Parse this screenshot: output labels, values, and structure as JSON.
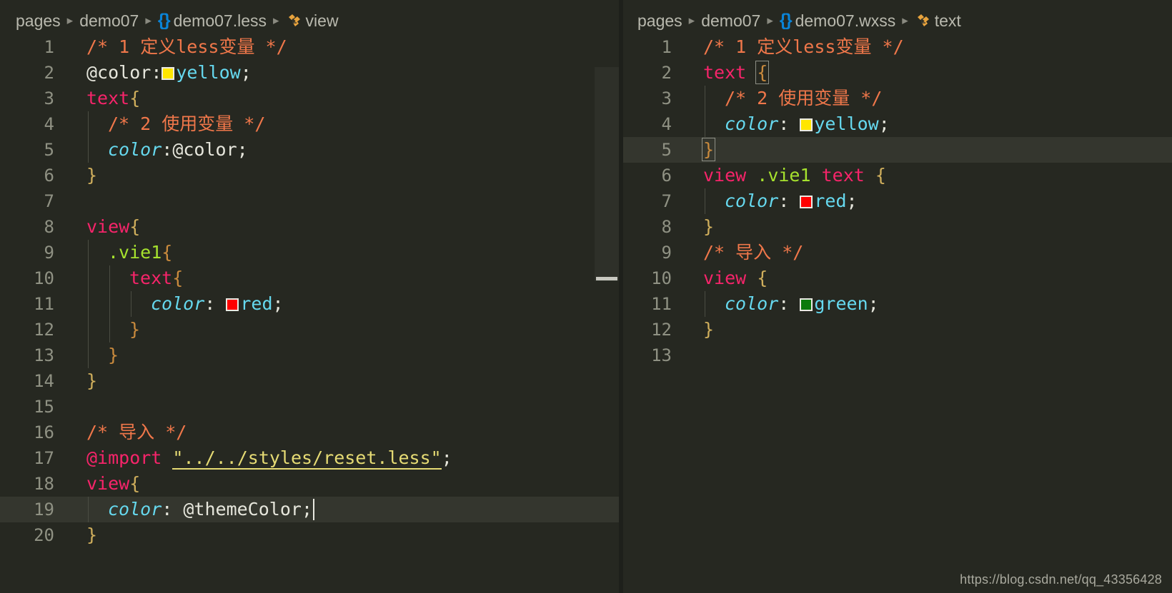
{
  "window": {
    "theme_bg": "#262821",
    "accent_blue": "#0a84d8",
    "current_line_bg": "#34362e"
  },
  "tabstrip": {
    "left_tab_label": "",
    "right_tab_label": ""
  },
  "left_pane": {
    "breadcrumb": {
      "items": [
        "pages",
        "demo07",
        "demo07.less",
        "view"
      ],
      "separator": "▸",
      "file_icon": "{}",
      "symbol_icon": "symbol-ruler-icon"
    },
    "lines": [
      {
        "n": "1",
        "indent": 0,
        "tokens": [
          {
            "t": "comment",
            "s": "/* 1 定义less变量 */"
          }
        ]
      },
      {
        "n": "2",
        "indent": 0,
        "tokens": [
          {
            "t": "var",
            "s": "@color"
          },
          {
            "t": "punc",
            "s": ":"
          },
          {
            "t": "swatch",
            "s": "yellow"
          },
          {
            "t": "val",
            "s": "yellow"
          },
          {
            "t": "semi",
            "s": ";"
          }
        ]
      },
      {
        "n": "3",
        "indent": 0,
        "tokens": [
          {
            "t": "tag",
            "s": "text"
          },
          {
            "t": "brace",
            "s": "{"
          }
        ]
      },
      {
        "n": "4",
        "indent": 1,
        "tokens": [
          {
            "t": "comment",
            "s": "/* 2 使用变量 */"
          }
        ]
      },
      {
        "n": "5",
        "indent": 1,
        "tokens": [
          {
            "t": "prop",
            "s": "color"
          },
          {
            "t": "punc",
            "s": ":"
          },
          {
            "t": "var",
            "s": "@color"
          },
          {
            "t": "semi",
            "s": ";"
          }
        ]
      },
      {
        "n": "6",
        "indent": 0,
        "tokens": [
          {
            "t": "brace",
            "s": "}"
          }
        ]
      },
      {
        "n": "7",
        "indent": 0,
        "tokens": []
      },
      {
        "n": "8",
        "indent": 0,
        "tokens": [
          {
            "t": "tag",
            "s": "view"
          },
          {
            "t": "brace",
            "s": "{"
          }
        ]
      },
      {
        "n": "9",
        "indent": 1,
        "tokens": [
          {
            "t": "class",
            "s": ".vie1"
          },
          {
            "t": "brace2",
            "s": "{"
          }
        ]
      },
      {
        "n": "10",
        "indent": 2,
        "tokens": [
          {
            "t": "tag",
            "s": "text"
          },
          {
            "t": "brace2",
            "s": "{"
          }
        ]
      },
      {
        "n": "11",
        "indent": 3,
        "tokens": [
          {
            "t": "prop",
            "s": "color"
          },
          {
            "t": "punc",
            "s": ": "
          },
          {
            "t": "swatch",
            "s": "red"
          },
          {
            "t": "val",
            "s": "red"
          },
          {
            "t": "semi",
            "s": ";"
          }
        ]
      },
      {
        "n": "12",
        "indent": 2,
        "tokens": [
          {
            "t": "brace2",
            "s": "}"
          }
        ]
      },
      {
        "n": "13",
        "indent": 1,
        "tokens": [
          {
            "t": "brace2",
            "s": "}"
          }
        ]
      },
      {
        "n": "14",
        "indent": 0,
        "tokens": [
          {
            "t": "brace",
            "s": "}"
          }
        ]
      },
      {
        "n": "15",
        "indent": 0,
        "tokens": []
      },
      {
        "n": "16",
        "indent": 0,
        "tokens": [
          {
            "t": "comment",
            "s": "/* 导入 */"
          }
        ]
      },
      {
        "n": "17",
        "indent": 0,
        "tokens": [
          {
            "t": "at",
            "s": "@import"
          },
          {
            "t": "plain",
            "s": " "
          },
          {
            "t": "str",
            "s": "\"../../styles/reset.less\""
          },
          {
            "t": "semi",
            "s": ";"
          }
        ]
      },
      {
        "n": "18",
        "indent": 0,
        "tokens": [
          {
            "t": "tag",
            "s": "view"
          },
          {
            "t": "brace",
            "s": "{"
          }
        ]
      },
      {
        "n": "19",
        "indent": 1,
        "current": true,
        "caret": true,
        "tokens": [
          {
            "t": "prop",
            "s": "color"
          },
          {
            "t": "punc",
            "s": ": "
          },
          {
            "t": "var",
            "s": "@themeColor"
          },
          {
            "t": "semi",
            "s": ";"
          }
        ]
      },
      {
        "n": "20",
        "indent": 0,
        "tokens": [
          {
            "t": "brace",
            "s": "}"
          }
        ]
      }
    ]
  },
  "right_pane": {
    "breadcrumb": {
      "items": [
        "pages",
        "demo07",
        "demo07.wxss",
        "text"
      ],
      "separator": "▸",
      "file_icon": "{}",
      "symbol_icon": "symbol-ruler-icon"
    },
    "lines": [
      {
        "n": "1",
        "indent": 0,
        "tokens": [
          {
            "t": "comment",
            "s": "/* 1 定义less变量 */"
          }
        ]
      },
      {
        "n": "2",
        "indent": 0,
        "tokens": [
          {
            "t": "tag",
            "s": "text"
          },
          {
            "t": "plain",
            "s": " "
          },
          {
            "t": "bracket",
            "s": "{"
          }
        ]
      },
      {
        "n": "3",
        "indent": 1,
        "tokens": [
          {
            "t": "comment",
            "s": "/* 2 使用变量 */"
          }
        ]
      },
      {
        "n": "4",
        "indent": 1,
        "tokens": [
          {
            "t": "prop",
            "s": "color"
          },
          {
            "t": "punc",
            "s": ": "
          },
          {
            "t": "swatch",
            "s": "yellow"
          },
          {
            "t": "val",
            "s": "yellow"
          },
          {
            "t": "semi",
            "s": ";"
          }
        ]
      },
      {
        "n": "5",
        "indent": 0,
        "current": true,
        "tokens": [
          {
            "t": "bracket",
            "s": "}"
          }
        ]
      },
      {
        "n": "6",
        "indent": 0,
        "tokens": [
          {
            "t": "tag",
            "s": "view"
          },
          {
            "t": "plain",
            "s": " "
          },
          {
            "t": "class",
            "s": ".vie1"
          },
          {
            "t": "plain",
            "s": " "
          },
          {
            "t": "tag",
            "s": "text"
          },
          {
            "t": "plain",
            "s": " "
          },
          {
            "t": "brace",
            "s": "{"
          }
        ]
      },
      {
        "n": "7",
        "indent": 1,
        "tokens": [
          {
            "t": "prop",
            "s": "color"
          },
          {
            "t": "punc",
            "s": ": "
          },
          {
            "t": "swatch",
            "s": "red"
          },
          {
            "t": "val",
            "s": "red"
          },
          {
            "t": "semi",
            "s": ";"
          }
        ]
      },
      {
        "n": "8",
        "indent": 0,
        "tokens": [
          {
            "t": "brace",
            "s": "}"
          }
        ]
      },
      {
        "n": "9",
        "indent": 0,
        "tokens": [
          {
            "t": "comment",
            "s": "/* 导入 */"
          }
        ]
      },
      {
        "n": "10",
        "indent": 0,
        "tokens": [
          {
            "t": "tag",
            "s": "view"
          },
          {
            "t": "plain",
            "s": " "
          },
          {
            "t": "brace",
            "s": "{"
          }
        ]
      },
      {
        "n": "11",
        "indent": 1,
        "tokens": [
          {
            "t": "prop",
            "s": "color"
          },
          {
            "t": "punc",
            "s": ": "
          },
          {
            "t": "swatch",
            "s": "green"
          },
          {
            "t": "val",
            "s": "green"
          },
          {
            "t": "semi",
            "s": ";"
          }
        ]
      },
      {
        "n": "12",
        "indent": 0,
        "tokens": [
          {
            "t": "brace",
            "s": "}"
          }
        ]
      },
      {
        "n": "13",
        "indent": 0,
        "tokens": []
      }
    ]
  },
  "swatch_colors": {
    "yellow": "#ffe600",
    "red": "#fe0000",
    "green": "#0c7a0c"
  },
  "watermark": "https://blog.csdn.net/qq_43356428"
}
